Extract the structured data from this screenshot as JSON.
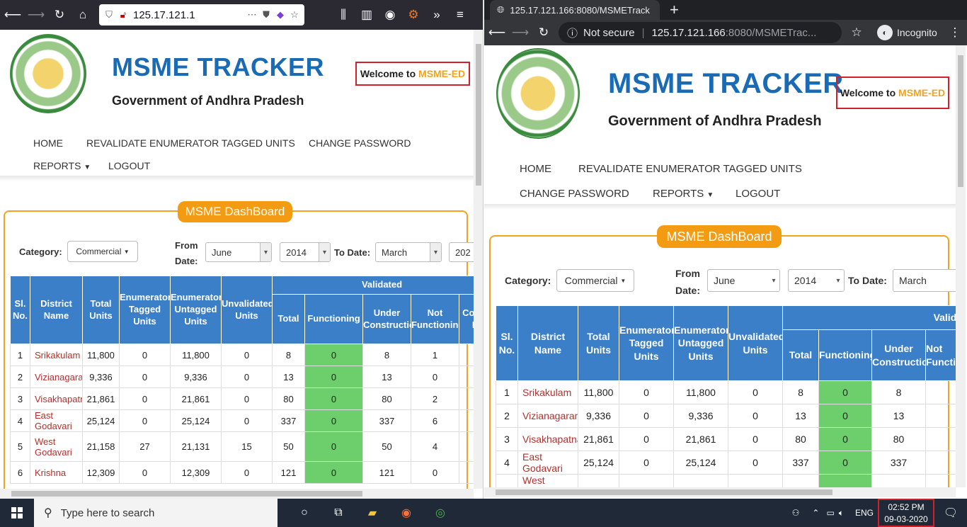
{
  "left_browser": {
    "url": "125.17.121.1",
    "toolbar_icons": [
      "back-icon",
      "forward-icon",
      "reload-icon",
      "home-icon"
    ]
  },
  "right_browser": {
    "tab_title": "125.17.121.166:8080/MSMETrack",
    "security": "Not secure",
    "url_host": "125.17.121.166",
    "url_rest": ":8080/MSMETrac...",
    "profile": "Incognito"
  },
  "site": {
    "title": "MSME TRACKER",
    "subtitle": "Government of Andhra Pradesh",
    "welcome_prefix": "Welcome to ",
    "welcome_org": "MSME-ED",
    "nav": {
      "home": "HOME",
      "revalidate": "REVALIDATE ENUMERATOR TAGGED UNITS",
      "change_password": "CHANGE PASSWORD",
      "reports": "REPORTS",
      "logout": "LOGOUT"
    },
    "dashboard_label": "MSME DashBoard",
    "filters": {
      "category_label": "Category:",
      "category_value": "Commercial",
      "from_label_1": "From",
      "from_label_2": "Date:",
      "from_month": "June",
      "from_year": "2014",
      "to_label": "To Date:",
      "to_month": "March",
      "to_year_partial": "202"
    },
    "table": {
      "headers": {
        "slno": "Sl. No.",
        "district": "District Name",
        "total_units": "Total Units",
        "tagged": "Enumerator Tagged Units",
        "untagged": "Enumerator Untagged Units",
        "unvalidated": "Unvalidated Units",
        "validated": "Validated",
        "total": "Total",
        "functioning": "Functioning",
        "under_construction": "Under Construction",
        "not_functioning": "Not Functioning",
        "partial_col": "Co no N"
      },
      "rows": [
        {
          "sl": "1",
          "district": "Srikakulam",
          "total": "11,800",
          "tagged": "0",
          "untagged": "11,800",
          "unval": "0",
          "vtotal": "8",
          "func": "0",
          "uc": "8",
          "nf": "1"
        },
        {
          "sl": "2",
          "district": "Vizianagaram",
          "total": "9,336",
          "tagged": "0",
          "untagged": "9,336",
          "unval": "0",
          "vtotal": "13",
          "func": "0",
          "uc": "13",
          "nf": "0"
        },
        {
          "sl": "3",
          "district": "Visakhapatnam",
          "total": "21,861",
          "tagged": "0",
          "untagged": "21,861",
          "unval": "0",
          "vtotal": "80",
          "func": "0",
          "uc": "80",
          "nf": "2"
        },
        {
          "sl": "4",
          "district": "East Godavari",
          "total": "25,124",
          "tagged": "0",
          "untagged": "25,124",
          "unval": "0",
          "vtotal": "337",
          "func": "0",
          "uc": "337",
          "nf": "6"
        },
        {
          "sl": "5",
          "district": "West Godavari",
          "total": "21,158",
          "tagged": "27",
          "untagged": "21,131",
          "unval": "15",
          "vtotal": "50",
          "func": "0",
          "uc": "50",
          "nf": "4"
        },
        {
          "sl": "6",
          "district": "Krishna",
          "total": "12,309",
          "tagged": "0",
          "untagged": "12,309",
          "unval": "0",
          "vtotal": "121",
          "func": "0",
          "uc": "121",
          "nf": "0"
        }
      ],
      "right_partial_district": "West"
    }
  },
  "taskbar": {
    "search_placeholder": "Type here to search",
    "lang": "ENG",
    "time": "02:52 PM",
    "date": "09-03-2020"
  },
  "colors": {
    "accent_blue": "#1a6bb5",
    "orange": "#f4a31e",
    "table_header": "#3a7fc8",
    "functioning_green": "#6ccf6c",
    "district_red": "#b2302c",
    "highlight_red": "#d0202a"
  }
}
